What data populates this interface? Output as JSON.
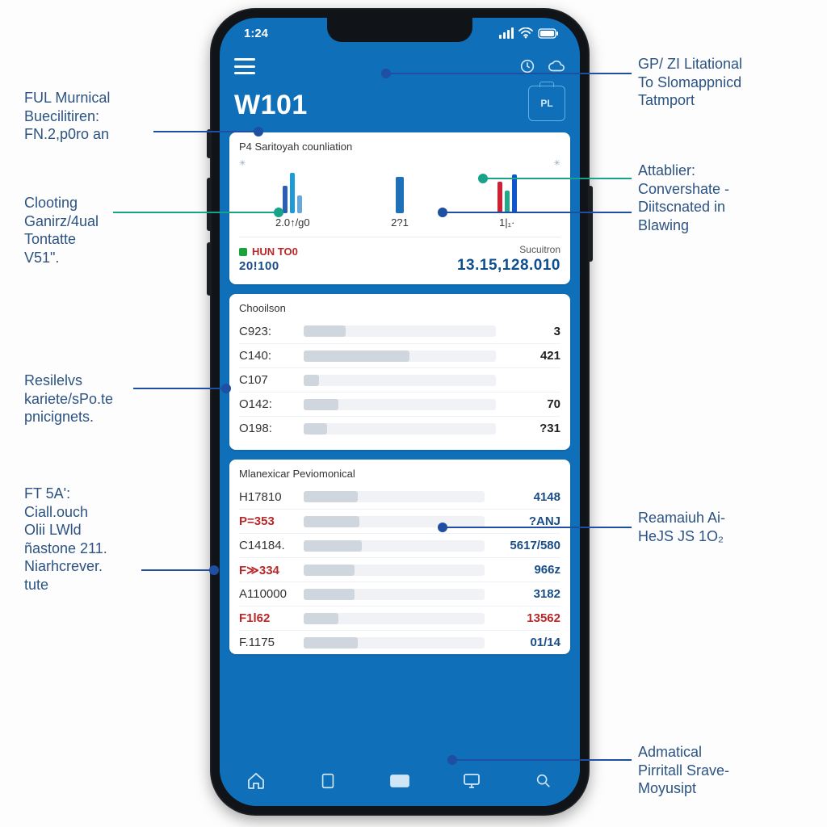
{
  "clock": "1:24",
  "title": "W101",
  "badge": "PL",
  "card1": {
    "title": "P4 Saritoyah counliation",
    "cols": [
      "2.0↑/g0",
      "2?1",
      "1|₁·"
    ],
    "sum_left_code": "HUN TO0",
    "sum_left_num": "20!100",
    "sum_right_label": "Sucuitron",
    "sum_value": "13.15,128.010"
  },
  "card2": {
    "title": "Chooilson",
    "rows": [
      {
        "k": "C923:",
        "fill": 22,
        "v": "3"
      },
      {
        "k": "C140:",
        "fill": 55,
        "v": "421"
      },
      {
        "k": "C107",
        "fill": 8,
        "v": ""
      },
      {
        "k": "O142:",
        "fill": 18,
        "v": "70"
      },
      {
        "k": "O198:",
        "fill": 12,
        "v": "?31"
      }
    ]
  },
  "card3": {
    "title": "Mlanexicar Peviomonical",
    "rows": [
      {
        "k": "H17810",
        "v": "",
        "v2": "4148"
      },
      {
        "k": "P=353",
        "red": true,
        "v": "",
        "v2": "?ANJ",
        "v2small": true
      },
      {
        "k": "C14184.",
        "v": "",
        "v2": "5617/580"
      },
      {
        "k": "F≫334",
        "red": true,
        "v": "",
        "v2": "966z"
      },
      {
        "k": "A110000",
        "v": "",
        "v2": "3182"
      },
      {
        "k": "F1l62",
        "red": true,
        "v": "",
        "v2": "13562",
        "v2red": true
      },
      {
        "k": "F.1175",
        "v": "",
        "v2": "01/14"
      }
    ]
  },
  "callouts": {
    "c1": "FUL Murnical\nBuecilitiren:\nFN.2,p0ro an",
    "c2": "Clooting\nGanirz/4ual\nTontatte\nV51\".",
    "c3": "Resilelvs\nkariete/sPo.te\npnicignets.",
    "c4": "FT 5A':\nCiall.ouch\nOlii LWld\nñastone 211.\nNiarhcrever.\ntute",
    "c5": "GP/ ZI Litational\nTo Slomappnicd\nTatmport",
    "c6": "Attablier:\nConvershate -\nDiitscnated in\nBlawing",
    "c7": "Reamaiuh Ai-\nHeJS JS 1O₂",
    "c8": "Admatical\nPirritall Srave-\nMoyusipt"
  }
}
